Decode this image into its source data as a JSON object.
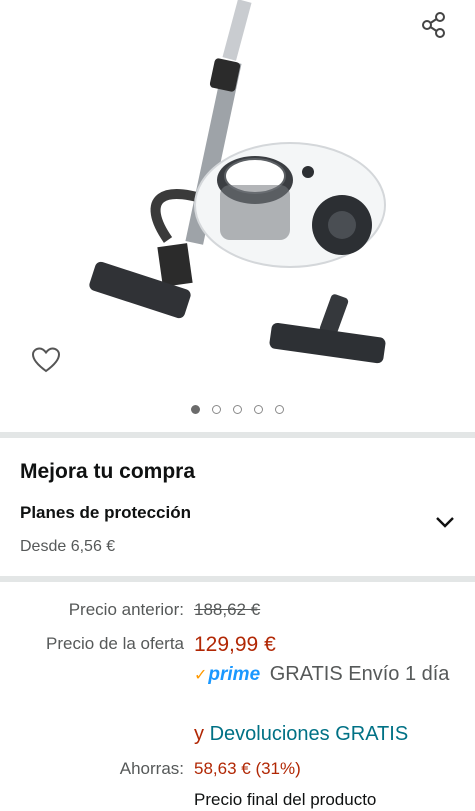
{
  "gallery": {
    "image_alt": "Aspiradora sin bolsa",
    "share_icon": "share-icon",
    "favorite_icon": "heart-icon",
    "dots_count": 5,
    "active_dot": 0
  },
  "upgrade": {
    "title": "Mejora tu compra",
    "plans_title": "Planes de protección",
    "plans_price": "Desde 6,56 €",
    "expand_icon": "chevron-down-icon"
  },
  "pricing": {
    "previous_label": "Precio anterior:",
    "previous_value": "188,62 €",
    "deal_label": "Precio de la oferta",
    "deal_value": "129,99 €",
    "prime_label": "prime",
    "shipping_text": "GRATIS Envío 1 día",
    "returns_prefix": "y",
    "returns_link": "Devoluciones GRATIS",
    "savings_label": "Ahorras:",
    "savings_value": "58,63 € (31%)",
    "final_price_text": "Precio final del producto"
  },
  "colors": {
    "price_red": "#b12704",
    "link_teal": "#007185",
    "prime_blue": "#1a98ff",
    "prime_orange": "#ff9900",
    "divider": "#e3e6e6"
  }
}
